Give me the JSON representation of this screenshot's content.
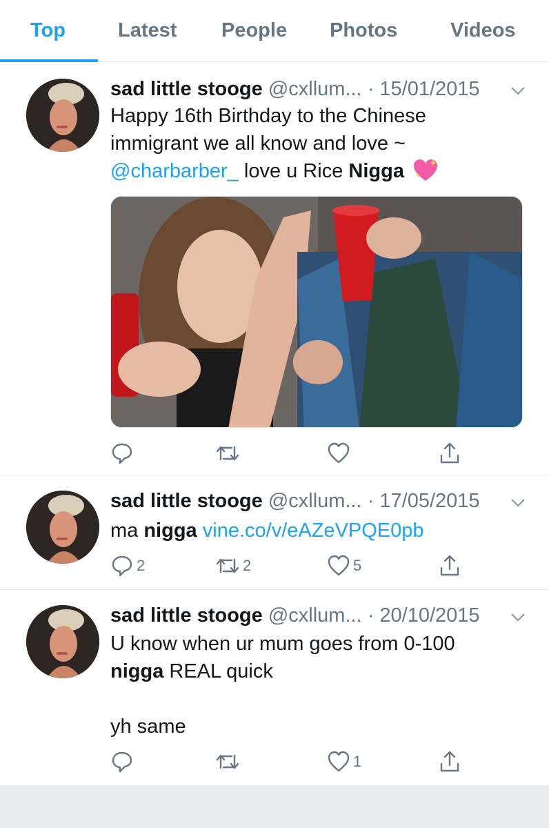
{
  "tabs": [
    "Top",
    "Latest",
    "People",
    "Photos",
    "Videos"
  ],
  "tweets": [
    {
      "name": "sad little stooge",
      "handle": "@cxllum...",
      "date": "· 15/01/2015",
      "lines": [
        {
          "plain": "Happy 16th Birthday to the Chinese"
        },
        {
          "plain": "immigrant we all know and love ~"
        },
        {
          "link": "@charbarber_",
          "plain": " love u Rice ",
          "bold": "Nigga",
          "emoji": "sparkling-heart-emoji"
        }
      ],
      "image": "photo-two-people-red-cups",
      "stats": {
        "reply": "",
        "retweet": "",
        "like": ""
      }
    },
    {
      "name": "sad little stooge",
      "handle": "@cxllum...",
      "date": "· 17/05/2015",
      "lines": [
        {
          "plain": "ma ",
          "bold": "nigga",
          "link": "vine.co/v/eAZeVPQE0pb"
        }
      ],
      "stats": {
        "reply": "2",
        "retweet": "2",
        "like": "5"
      }
    },
    {
      "name": "sad little stooge",
      "handle": "@cxllum...",
      "date": "· 20/10/2015",
      "lines": [
        {
          "plain": "U know when ur mum goes from 0-100"
        },
        {
          "bold": "nigga",
          "plain": " REAL quick"
        },
        {
          "plain": ""
        },
        {
          "plain": "yh same"
        }
      ],
      "stats": {
        "reply": "",
        "retweet": "",
        "like": "1"
      }
    }
  ],
  "colors": {
    "accent": "#1da1f2",
    "muted": "#657786",
    "text": "#14171a",
    "border": "#e1e8ed"
  }
}
